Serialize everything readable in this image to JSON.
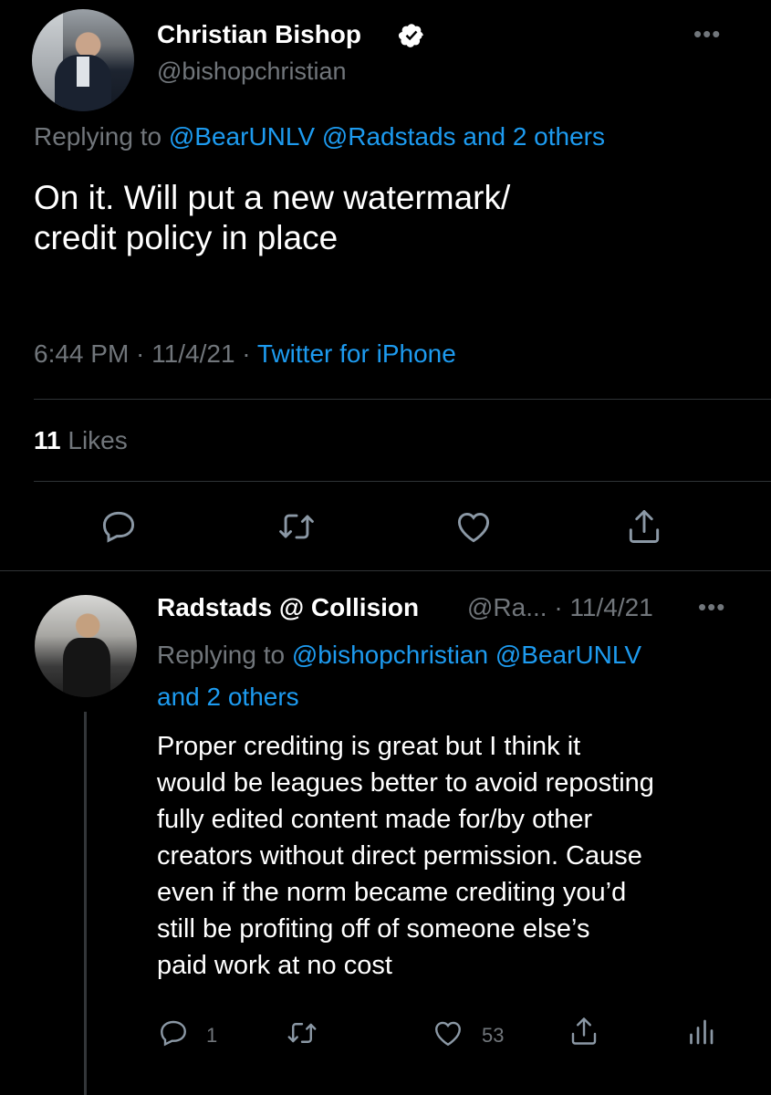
{
  "main_tweet": {
    "display_name": "Christian Bishop",
    "handle": "@bishopchristian",
    "more_label": "•••",
    "replying_prefix": "Replying to",
    "replying_to": "@BearUNLV @Radstads and 2 others",
    "text_line1": "On it. Will put a new watermark/",
    "text_line2": "credit policy in place",
    "time": "6:44 PM",
    "sep1": " · ",
    "date": "11/4/21",
    "sep2": " · ",
    "source": "Twitter for iPhone",
    "likes_count": "11",
    "likes_label": " Likes",
    "actions": [
      "reply",
      "retweet",
      "like",
      "share"
    ]
  },
  "reply_tweet": {
    "display_name": "Radstads @ Collision",
    "handle_date": "@Ra... · 11/4/21",
    "more_label": "•••",
    "replying_prefix": "Replying to",
    "replying_to_line1": "@bishopchristian @BearUNLV",
    "replying_to_line2": "and 2 others",
    "text_lines": [
      "Proper crediting is great but I think it",
      "would be leagues better to avoid reposting",
      "fully edited content made for/by other",
      "creators without direct permission. Cause",
      "even if the norm became crediting you’d",
      "still be profiting off of someone else’s",
      "paid work at no cost"
    ],
    "reply_count": "1",
    "retweet_count": "",
    "like_count": "53"
  },
  "colors": {
    "background": "#000000",
    "link": "#1d9bf0",
    "muted": "#71767b",
    "text": "#e7e9ea",
    "verified": "#ffffff"
  }
}
